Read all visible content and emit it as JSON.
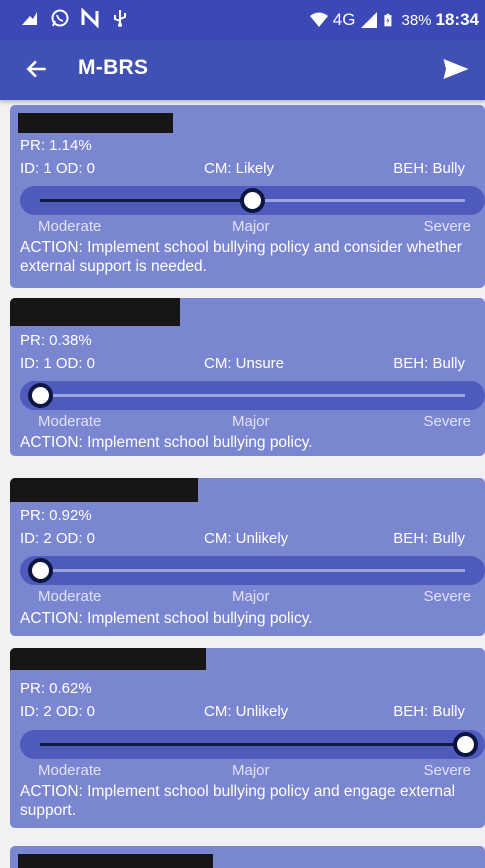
{
  "status_bar": {
    "network": "4G",
    "battery": "38%",
    "time": "18:34",
    "icons": [
      "notification-icon",
      "whatsapp-icon",
      "n-icon",
      "usb-icon",
      "wifi-icon",
      "signal-icon",
      "battery-icon"
    ]
  },
  "app_bar": {
    "title": "M-BRS",
    "back_icon": "arrow-back-icon",
    "send_icon": "send-icon",
    "color": "#3f51b5"
  },
  "scale_labels": {
    "low": "Moderate",
    "mid": "Major",
    "high": "Severe"
  },
  "cards": [
    {
      "pr": "PR: 1.14%",
      "id_od": "ID: 1 OD: 0",
      "cm": "CM: Likely",
      "beh": "BEH: Bully",
      "level": 0.5,
      "action": "ACTION: Implement school bullying policy and consider whether external support is needed."
    },
    {
      "pr": "PR: 0.38%",
      "id_od": "ID: 1 OD: 0",
      "cm": "CM: Unsure",
      "beh": "BEH: Bully",
      "level": 0,
      "action": "ACTION: Implement school bullying policy."
    },
    {
      "pr": "PR: 0.92%",
      "id_od": "ID: 2 OD: 0",
      "cm": "CM: Unlikely",
      "beh": "BEH: Bully",
      "level": 0,
      "action": "ACTION: Implement school bullying policy."
    },
    {
      "pr": "PR: 0.62%",
      "id_od": "ID: 2 OD: 0",
      "cm": "CM: Unlikely",
      "beh": "BEH: Bully",
      "level": 1,
      "action": "ACTION: Implement school bullying policy and engage external support."
    }
  ]
}
